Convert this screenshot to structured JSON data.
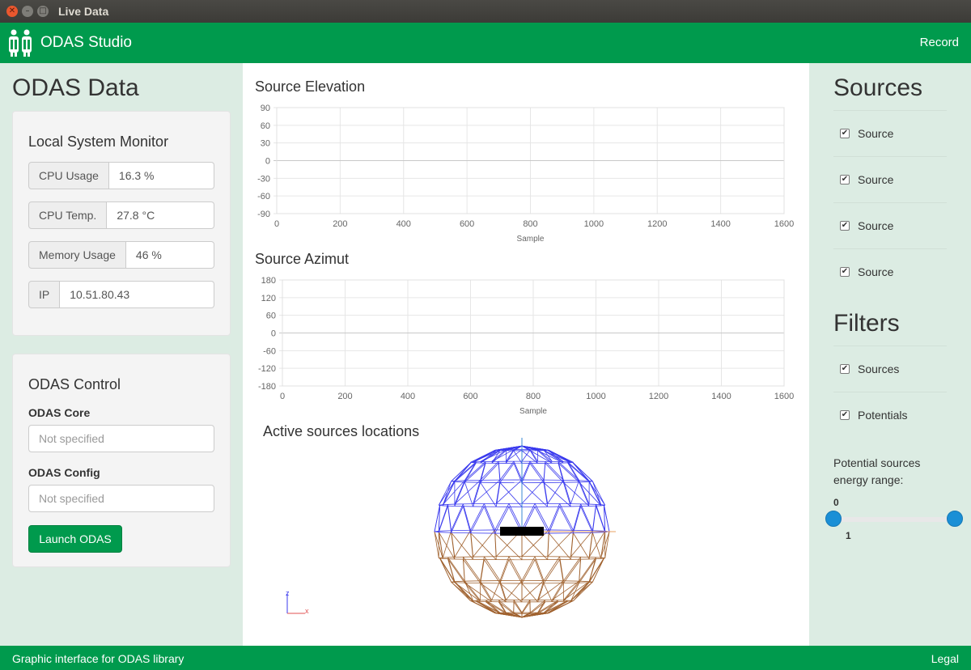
{
  "window": {
    "title": "Live Data"
  },
  "navbar": {
    "brand": "ODAS Studio",
    "record": "Record"
  },
  "left": {
    "title": "ODAS Data",
    "monitor": {
      "title": "Local System Monitor",
      "cpu_label": "CPU Usage",
      "cpu_value": "16.3 %",
      "temp_label": "CPU Temp.",
      "temp_value": "27.8 °C",
      "mem_label": "Memory Usage",
      "mem_value": "46 %",
      "ip_label": "IP",
      "ip_value": "10.51.80.43"
    },
    "control": {
      "title": "ODAS Control",
      "core_label": "ODAS Core",
      "core_placeholder": "Not specified",
      "config_label": "ODAS Config",
      "config_placeholder": "Not specified",
      "launch": "Launch ODAS"
    }
  },
  "center": {
    "elevation_title": "Source Elevation",
    "azimuth_title": "Source Azimut",
    "locations_title": "Active sources locations",
    "axes_legend": {
      "z": "z",
      "x": "x"
    }
  },
  "chart_data": [
    {
      "type": "line",
      "title": "Source Elevation",
      "xlabel": "Sample",
      "ylabel": "",
      "xlim": [
        0,
        1600
      ],
      "ylim": [
        -90,
        90
      ],
      "xticks": [
        0,
        200,
        400,
        600,
        800,
        1000,
        1200,
        1400,
        1600
      ],
      "yticks": [
        90,
        60,
        30,
        0,
        -30,
        -60,
        -90
      ],
      "grid": true,
      "series": []
    },
    {
      "type": "line",
      "title": "Source Azimut",
      "xlabel": "Sample",
      "ylabel": "",
      "xlim": [
        0,
        1600
      ],
      "ylim": [
        -180,
        180
      ],
      "xticks": [
        0,
        200,
        400,
        600,
        800,
        1000,
        1200,
        1400,
        1600
      ],
      "yticks": [
        180,
        120,
        60,
        0,
        -60,
        -120,
        -180
      ],
      "grid": true,
      "series": []
    }
  ],
  "right": {
    "sources_title": "Sources",
    "sources": [
      "Source",
      "Source",
      "Source",
      "Source"
    ],
    "filters_title": "Filters",
    "filters": [
      "Sources",
      "Potentials"
    ],
    "range_label": "Potential sources energy range:",
    "range_min": "0",
    "range_max": "1",
    "range_values": [
      0,
      1
    ]
  },
  "footer": {
    "text": "Graphic interface for ODAS library",
    "legal": "Legal"
  },
  "colors": {
    "green": "#009a4d",
    "panel": "#dcece3",
    "upper_sphere": "#3a3aee",
    "lower_sphere": "#a0622f"
  }
}
